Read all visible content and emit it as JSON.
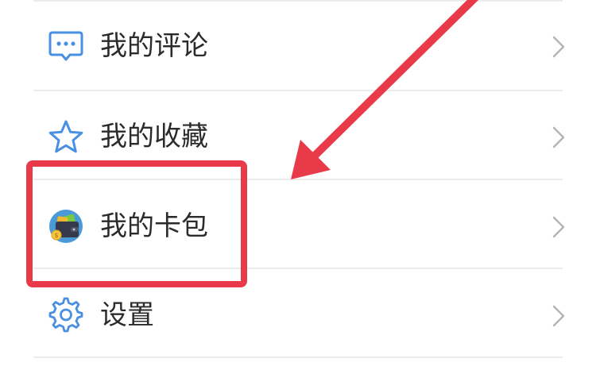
{
  "menu": {
    "items": [
      {
        "label": "我的评论",
        "icon": "comment-bubble-icon"
      },
      {
        "label": "我的收藏",
        "icon": "star-icon"
      },
      {
        "label": "我的卡包",
        "icon": "wallet-icon"
      },
      {
        "label": "设置",
        "icon": "gear-icon"
      }
    ],
    "chevron_icon": "chevron-right-icon"
  },
  "annotation": {
    "highlight_color": "#e83a48",
    "highlighted_item": "我的卡包"
  },
  "colors": {
    "icon_blue": "#4a90e2",
    "label_text": "#2b2b2b",
    "chevron": "#b5b5b5",
    "divider": "#ececec"
  }
}
